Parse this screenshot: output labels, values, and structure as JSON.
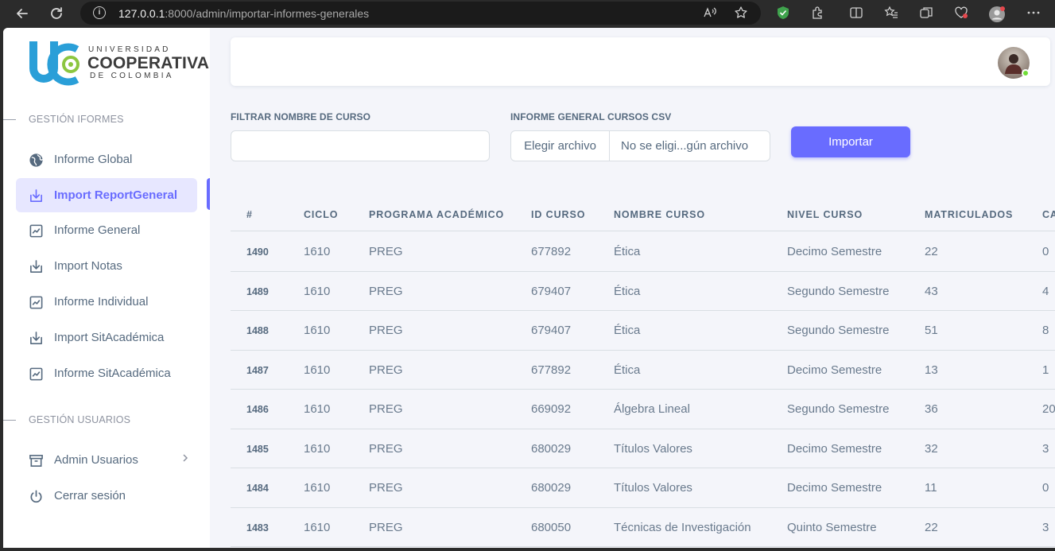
{
  "browser": {
    "url_host": "127.0.0.1",
    "url_rest": ":8000/admin/importar-informes-generales"
  },
  "brand": {
    "line1": "UNIVERSIDAD",
    "line2": "COOPERATIVA",
    "line3": "DE COLOMBIA",
    "colors": {
      "blue": "#2a9fd8",
      "green": "#8cc63f",
      "dark": "#3b3b3b"
    }
  },
  "sidebar": {
    "section_informes": "GESTIÓN IFORMES",
    "section_usuarios": "GESTIÓN USUARIOS",
    "items": [
      {
        "label": "Informe Global",
        "icon": "globe-icon"
      },
      {
        "label": "Import ReportGeneral",
        "icon": "download-icon",
        "active": true
      },
      {
        "label": "Informe General",
        "icon": "chart-icon"
      },
      {
        "label": "Import Notas",
        "icon": "download-icon"
      },
      {
        "label": "Informe Individual",
        "icon": "chart-icon"
      },
      {
        "label": "Import SitAcadémica",
        "icon": "download-icon"
      },
      {
        "label": "Informe SitAcadémica",
        "icon": "chart-icon"
      }
    ],
    "user_items": [
      {
        "label": "Admin Usuarios",
        "icon": "archive-icon"
      },
      {
        "label": "Cerrar sesión",
        "icon": "power-icon"
      }
    ]
  },
  "form": {
    "filter_label": "FILTRAR NOMBRE DE CURSO",
    "filter_value": "",
    "csv_label": "INFORME GENERAL CURSOS CSV",
    "file_button": "Elegir archivo",
    "file_name": "No se eligi...gún archivo",
    "import_button": "Importar"
  },
  "colors": {
    "accent": "#696cff",
    "text": "#566a7f",
    "muted": "#697a8d"
  },
  "table": {
    "headers": [
      "#",
      "CICLO",
      "PROGRAMA ACADÉMICO",
      "ID CURSO",
      "NOMBRE CURSO",
      "NIVEL CURSO",
      "MATRICULADOS",
      "CA"
    ],
    "rows": [
      [
        "1490",
        "1610",
        "PREG",
        "677892",
        "Ética",
        "Decimo Semestre",
        "22",
        "0"
      ],
      [
        "1489",
        "1610",
        "PREG",
        "679407",
        "Ética",
        "Segundo Semestre",
        "43",
        "4"
      ],
      [
        "1488",
        "1610",
        "PREG",
        "679407",
        "Ética",
        "Segundo Semestre",
        "51",
        "8"
      ],
      [
        "1487",
        "1610",
        "PREG",
        "677892",
        "Ética",
        "Decimo Semestre",
        "13",
        "1"
      ],
      [
        "1486",
        "1610",
        "PREG",
        "669092",
        "Álgebra Lineal",
        "Segundo Semestre",
        "36",
        "20"
      ],
      [
        "1485",
        "1610",
        "PREG",
        "680029",
        "Títulos Valores",
        "Decimo Semestre",
        "32",
        "3"
      ],
      [
        "1484",
        "1610",
        "PREG",
        "680029",
        "Títulos Valores",
        "Decimo Semestre",
        "11",
        "0"
      ],
      [
        "1483",
        "1610",
        "PREG",
        "680050",
        "Técnicas de Investigación",
        "Quinto Semestre",
        "22",
        "3"
      ]
    ]
  }
}
